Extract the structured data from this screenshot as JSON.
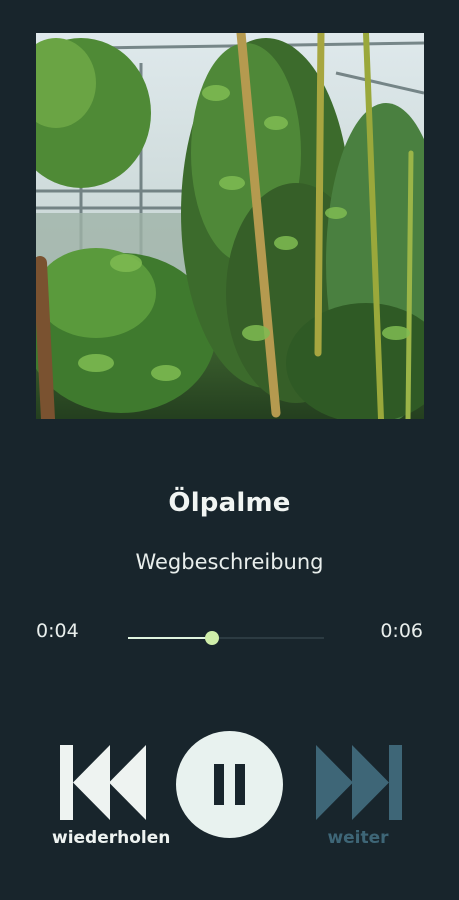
{
  "track": {
    "title": "Ölpalme",
    "subtitle": "Wegbeschreibung"
  },
  "player": {
    "elapsed": "0:04",
    "total": "0:06",
    "progress_fraction": 0.43
  },
  "controls": {
    "previous_label": "wiederholen",
    "next_label": "weiter",
    "play_state": "playing",
    "play_icon": "pause-icon",
    "previous_icon": "skip-previous-icon",
    "next_icon": "skip-next-icon"
  },
  "colors": {
    "background": "#18252c",
    "accent": "#cfeeaa",
    "disabled": "#3e6677",
    "button_fill": "#e8f2ef"
  }
}
